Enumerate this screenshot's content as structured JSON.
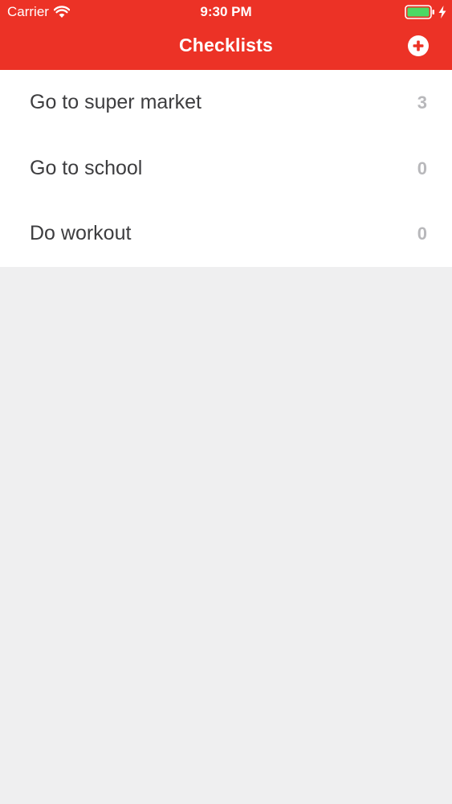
{
  "status_bar": {
    "carrier": "Carrier",
    "time": "9:30 PM"
  },
  "nav": {
    "title": "Checklists",
    "add_icon": "plus-circle-icon"
  },
  "checklists": [
    {
      "title": "Go to super market",
      "count": "3"
    },
    {
      "title": "Go to school",
      "count": "0"
    },
    {
      "title": "Do workout",
      "count": "0"
    }
  ],
  "colors": {
    "accent": "#ec3226",
    "background": "#efeff0",
    "row_background": "#ffffff",
    "title_text": "#3d3d3f",
    "count_text": "#b8b8bb",
    "battery_level": "#4cd964"
  }
}
